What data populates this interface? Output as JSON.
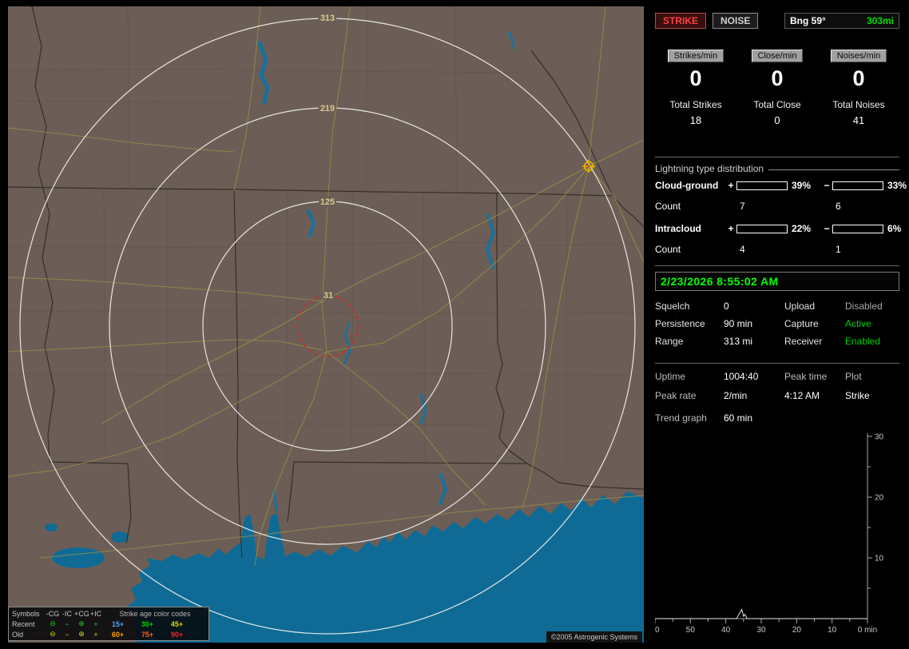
{
  "toolbar": {
    "strike": "STRIKE",
    "noise": "NOISE",
    "bearing": "Bng 59°",
    "range": "303mi"
  },
  "counters": [
    {
      "label": "Strikes/min",
      "value": "0",
      "total_label": "Total Strikes",
      "total_value": "18"
    },
    {
      "label": "Close/min",
      "value": "0",
      "total_label": "Total Close",
      "total_value": "0"
    },
    {
      "label": "Noises/min",
      "value": "0",
      "total_label": "Total Noises",
      "total_value": "41"
    }
  ],
  "distribution": {
    "title": "Lightning type distribution",
    "count_label": "Count",
    "rows": [
      {
        "label": "Cloud-ground",
        "plus_sign": "+",
        "minus_sign": "−",
        "plus_pct": "39%",
        "minus_pct": "33%",
        "plus_count": "7",
        "minus_count": "6",
        "plus_color": "#ff1414",
        "minus_color": "#74b6ee",
        "plus_fill": "84%",
        "minus_fill": "71%"
      },
      {
        "label": "Intracloud",
        "plus_sign": "+",
        "minus_sign": "−",
        "plus_pct": "22%",
        "minus_pct": "6%",
        "plus_count": "4",
        "minus_count": "1",
        "plus_color": "#ee6ed2",
        "minus_color": "#00c020",
        "plus_fill": "47%",
        "minus_fill": "13%"
      }
    ]
  },
  "clock": {
    "datetime": "2/23/2026 8:55:02 AM"
  },
  "settings": {
    "rows": [
      {
        "label1": "Squelch",
        "value1": "0",
        "label2": "Upload",
        "value2": "Disabled",
        "value2_color": "#a8a8a8"
      },
      {
        "label1": "Persistence",
        "value1": "90 min",
        "label2": "Capture",
        "value2": "Active",
        "value2_color": "#00d000"
      },
      {
        "label1": "Range",
        "value1": "313 mi",
        "label2": "Receiver",
        "value2": "Enabled",
        "value2_color": "#00d000"
      }
    ]
  },
  "stats": {
    "uptime_label": "Uptime",
    "uptime_value": "1004:40",
    "peak_time_label": "Peak time",
    "plot_label": "Plot",
    "peak_rate_label": "Peak rate",
    "peak_rate_value": "2/min",
    "peak_time_value": "4:12 AM",
    "plot_value": "Strike",
    "trend_label": "Trend graph",
    "trend_value": "60 min"
  },
  "trend_chart": {
    "type": "line",
    "title": "Strike trend, last 60 minutes",
    "x_ticks": [
      60,
      50,
      40,
      30,
      20,
      10,
      0
    ],
    "x_last_label": "0 min",
    "y_ticks": [
      10,
      20,
      30
    ],
    "ylim": [
      0,
      30
    ],
    "points": [
      [
        60,
        0
      ],
      [
        37,
        0
      ],
      [
        35.5,
        1.5
      ],
      [
        35,
        0.4
      ],
      [
        34.6,
        0.7
      ],
      [
        34,
        0
      ],
      [
        0,
        0
      ]
    ],
    "line_color": "#e8e8e8"
  },
  "map": {
    "ring_labels": [
      "313",
      "219",
      "125",
      "31"
    ],
    "credit": "©2005 Astrogenic Systems",
    "legend": {
      "symbols_header": "Symbols",
      "columns": [
        "-CG",
        "-IC",
        "+CG",
        "+IC"
      ],
      "symbols": [
        "⊖",
        "−",
        "⊕",
        "+"
      ],
      "age_header": "Strike age color codes",
      "rows": [
        {
          "label": "Recent",
          "color": "#20d020",
          "ages": [
            {
              "text": "15+",
              "color": "#50a0ff"
            },
            {
              "text": "30+",
              "color": "#00d000"
            },
            {
              "text": "45+",
              "color": "#d8d800"
            }
          ]
        },
        {
          "label": "Old",
          "color": "#d8d820",
          "ages": [
            {
              "text": "60+",
              "color": "#ffa000"
            },
            {
              "text": "75+",
              "color": "#ff6020"
            },
            {
              "text": "90+",
              "color": "#ff2020"
            }
          ]
        }
      ]
    }
  }
}
